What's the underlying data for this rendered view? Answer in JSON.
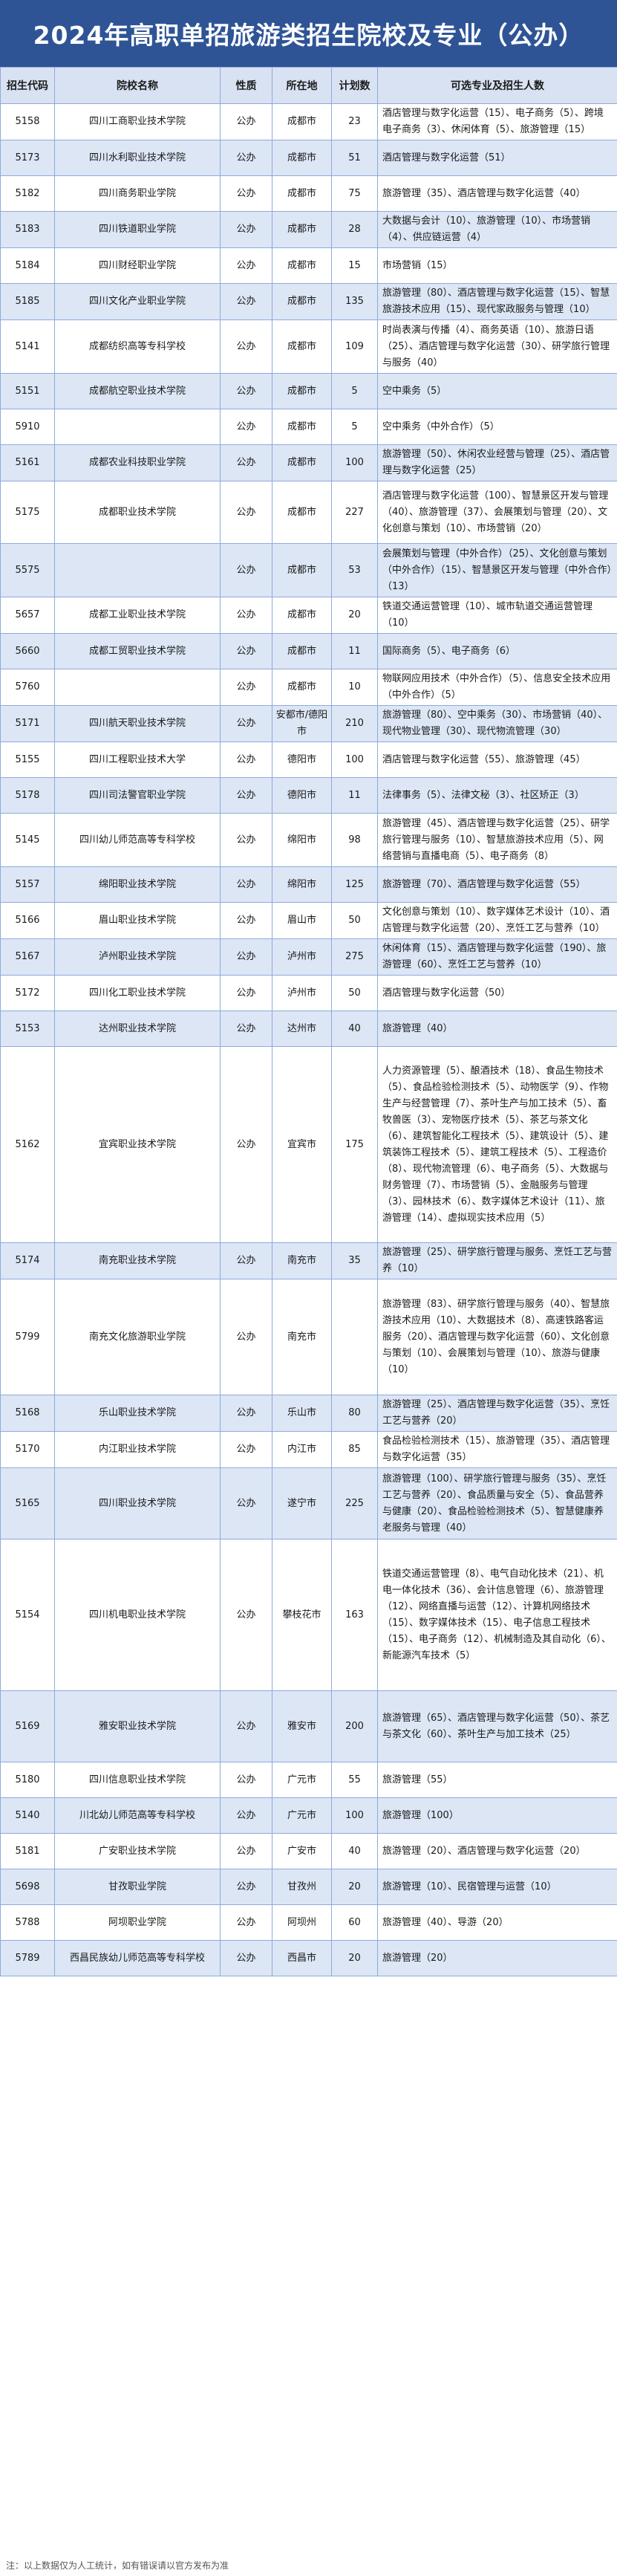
{
  "title": "2024年高职单招旅游类招生院校及专业（公办）",
  "headers": [
    "招生代码",
    "院校名称",
    "性质",
    "所在地",
    "计划数",
    "可选专业及招生人数"
  ],
  "rows": [
    {
      "code": "5158",
      "school": "四川工商职业技术学院",
      "type": "公办",
      "city": "成都市",
      "plan": "23",
      "majors": "酒店管理与数字化运营（15）、电子商务（5）、跨境电子商务（3）、休闲体育（5）、旅游管理（15）"
    },
    {
      "code": "5173",
      "school": "四川水利职业技术学院",
      "type": "公办",
      "city": "成都市",
      "plan": "51",
      "majors": "酒店管理与数字化运营（51）"
    },
    {
      "code": "5182",
      "school": "四川商务职业学院",
      "type": "公办",
      "city": "成都市",
      "plan": "75",
      "majors": "旅游管理（35）、酒店管理与数字化运营（40）"
    },
    {
      "code": "5183",
      "school": "四川铁道职业学院",
      "type": "公办",
      "city": "成都市",
      "plan": "28",
      "majors": "大数据与会计（10）、旅游管理（10）、市场营销（4）、供应链运营（4）"
    },
    {
      "code": "5184",
      "school": "四川财经职业学院",
      "type": "公办",
      "city": "成都市",
      "plan": "15",
      "majors": "市场营销（15）"
    },
    {
      "code": "5185",
      "school": "四川文化产业职业学院",
      "type": "公办",
      "city": "成都市",
      "plan": "135",
      "majors": "旅游管理（80）、酒店管理与数字化运营（15）、智慧旅游技术应用（15）、现代家政服务与管理（10）"
    },
    {
      "code": "5141",
      "school": "成都纺织高等专科学校",
      "type": "公办",
      "city": "成都市",
      "plan": "109",
      "majors": "时尚表演与传播（4）、商务英语（10）、旅游日语（25）、酒店管理与数字化运营（30）、研学旅行管理与服务（40）"
    },
    {
      "code": "5151",
      "school": "成都航空职业技术学院",
      "type": "公办",
      "city": "成都市",
      "plan": "5",
      "majors": "空中乘务（5）"
    },
    {
      "code": "5910",
      "school": "",
      "type": "公办",
      "city": "成都市",
      "plan": "5",
      "majors": "空中乘务（中外合作）（5）"
    },
    {
      "code": "5161",
      "school": "成都农业科技职业学院",
      "type": "公办",
      "city": "成都市",
      "plan": "100",
      "majors": "旅游管理（50）、休闲农业经营与管理（25）、酒店管理与数字化运营（25）"
    },
    {
      "code": "5175",
      "school": "成都职业技术学院",
      "type": "公办",
      "city": "成都市",
      "plan": "227",
      "majors": "酒店管理与数字化运营（100）、智慧景区开发与管理（40）、旅游管理（37）、会展策划与管理（20）、文化创意与策划（10）、市场营销（20）"
    },
    {
      "code": "5575",
      "school": "",
      "type": "公办",
      "city": "成都市",
      "plan": "53",
      "majors": "会展策划与管理（中外合作）（25）、文化创意与策划（中外合作）（15）、智慧景区开发与管理（中外合作）（13）"
    },
    {
      "code": "5657",
      "school": "成都工业职业技术学院",
      "type": "公办",
      "city": "成都市",
      "plan": "20",
      "majors": "铁道交通运营管理（10）、城市轨道交通运营管理（10）"
    },
    {
      "code": "5660",
      "school": "成都工贸职业技术学院",
      "type": "公办",
      "city": "成都市",
      "plan": "11",
      "majors": "国际商务（5）、电子商务（6）"
    },
    {
      "code": "5760",
      "school": "",
      "type": "公办",
      "city": "成都市",
      "plan": "10",
      "majors": "物联网应用技术（中外合作）（5）、信息安全技术应用（中外合作）（5）"
    },
    {
      "code": "5171",
      "school": "四川航天职业技术学院",
      "type": "公办",
      "city": "安都市/德阳市",
      "plan": "210",
      "majors": "旅游管理（80）、空中乘务（30）、市场营销（40）、现代物业管理（30）、现代物流管理（30）"
    },
    {
      "code": "5155",
      "school": "四川工程职业技术大学",
      "type": "公办",
      "city": "德阳市",
      "plan": "100",
      "majors": "酒店管理与数字化运营（55）、旅游管理（45）"
    },
    {
      "code": "5178",
      "school": "四川司法警官职业学院",
      "type": "公办",
      "city": "德阳市",
      "plan": "11",
      "majors": "法律事务（5）、法律文秘（3）、社区矫正（3）"
    },
    {
      "code": "5145",
      "school": "四川幼儿师范高等专科学校",
      "type": "公办",
      "city": "绵阳市",
      "plan": "98",
      "majors": "旅游管理（45）、酒店管理与数字化运营（25）、研学旅行管理与服务（10）、智慧旅游技术应用（5）、网络营销与直播电商（5）、电子商务（8）"
    },
    {
      "code": "5157",
      "school": "绵阳职业技术学院",
      "type": "公办",
      "city": "绵阳市",
      "plan": "125",
      "majors": "旅游管理（70）、酒店管理与数字化运营（55）"
    },
    {
      "code": "5166",
      "school": "眉山职业技术学院",
      "type": "公办",
      "city": "眉山市",
      "plan": "50",
      "majors": "文化创意与策划（10）、数字媒体艺术设计（10）、酒店管理与数字化运营（20）、烹饪工艺与营养（10）"
    },
    {
      "code": "5167",
      "school": "泸州职业技术学院",
      "type": "公办",
      "city": "泸州市",
      "plan": "275",
      "majors": "休闲体育（15）、酒店管理与数字化运营（190）、旅游管理（60）、烹饪工艺与营养（10）"
    },
    {
      "code": "5172",
      "school": "四川化工职业技术学院",
      "type": "公办",
      "city": "泸州市",
      "plan": "50",
      "majors": "酒店管理与数字化运营（50）"
    },
    {
      "code": "5153",
      "school": "达州职业技术学院",
      "type": "公办",
      "city": "达州市",
      "plan": "40",
      "majors": "旅游管理（40）"
    },
    {
      "code": "5162",
      "school": "宜宾职业技术学院",
      "type": "公办",
      "city": "宜宾市",
      "plan": "175",
      "majors": "人力资源管理（5）、酿酒技术（18）、食品生物技术（5）、食品检验检测技术（5）、动物医学（9）、作物生产与经营管理（7）、茶叶生产与加工技术（5）、畜牧兽医（3）、宠物医疗技术（5）、茶艺与茶文化（6）、建筑智能化工程技术（5）、建筑设计（5）、建筑装饰工程技术（5）、建筑工程技术（5）、工程造价（8）、现代物流管理（6）、电子商务（5）、大数据与财务管理（7）、市场营销（5）、金融服务与管理（3）、园林技术（6）、数字媒体艺术设计（11）、旅游管理（14）、虚拟现实技术应用（5）"
    },
    {
      "code": "5174",
      "school": "南充职业技术学院",
      "type": "公办",
      "city": "南充市",
      "plan": "35",
      "majors": "旅游管理（25）、研学旅行管理与服务、烹饪工艺与营养（10）"
    },
    {
      "code": "5799",
      "school": "南充文化旅游职业学院",
      "type": "公办",
      "city": "南充市",
      "plan": "",
      "majors": "旅游管理（83）、研学旅行管理与服务（40）、智慧旅游技术应用（10）、大数据技术（8）、高速铁路客运服务（20）、酒店管理与数字化运营（60）、文化创意与策划（10）、会展策划与管理（10）、旅游与健康（10）"
    },
    {
      "code": "5168",
      "school": "乐山职业技术学院",
      "type": "公办",
      "city": "乐山市",
      "plan": "80",
      "majors": "旅游管理（25）、酒店管理与数字化运营（35）、烹饪工艺与营养（20）"
    },
    {
      "code": "5170",
      "school": "内江职业技术学院",
      "type": "公办",
      "city": "内江市",
      "plan": "85",
      "majors": "食品检验检测技术（15）、旅游管理（35）、酒店管理与数字化运营（35）"
    },
    {
      "code": "5165",
      "school": "四川职业技术学院",
      "type": "公办",
      "city": "遂宁市",
      "plan": "225",
      "majors": "旅游管理（100）、研学旅行管理与服务（35）、烹饪工艺与营养（20）、食品质量与安全（5）、食品营养与健康（20）、食品检验检测技术（5）、智慧健康养老服务与管理（40）"
    },
    {
      "code": "5154",
      "school": "四川机电职业技术学院",
      "type": "公办",
      "city": "攀枝花市",
      "plan": "163",
      "majors": "铁道交通运营管理（8）、电气自动化技术（21）、机电一体化技术（36）、会计信息管理（6）、旅游管理（12）、网络直播与运营（12）、计算机网络技术（15）、数字媒体技术（15）、电子信息工程技术（15）、电子商务（12）、机械制造及其自动化（6）、新能源汽车技术（5）"
    },
    {
      "code": "5169",
      "school": "雅安职业技术学院",
      "type": "公办",
      "city": "雅安市",
      "plan": "200",
      "majors": "旅游管理（65）、酒店管理与数字化运营（50）、茶艺与茶文化（60）、茶叶生产与加工技术（25）"
    },
    {
      "code": "5180",
      "school": "四川信息职业技术学院",
      "type": "公办",
      "city": "广元市",
      "plan": "55",
      "majors": "旅游管理（55）"
    },
    {
      "code": "5140",
      "school": "川北幼儿师范高等专科学校",
      "type": "公办",
      "city": "广元市",
      "plan": "100",
      "majors": "旅游管理（100）"
    },
    {
      "code": "5181",
      "school": "广安职业技术学院",
      "type": "公办",
      "city": "广安市",
      "plan": "40",
      "majors": "旅游管理（20）、酒店管理与数字化运营（20）"
    },
    {
      "code": "5698",
      "school": "甘孜职业学院",
      "type": "公办",
      "city": "甘孜州",
      "plan": "20",
      "majors": "旅游管理（10）、民宿管理与运营（10）"
    },
    {
      "code": "5788",
      "school": "阿坝职业学院",
      "type": "公办",
      "city": "阿坝州",
      "plan": "60",
      "majors": "旅游管理（40）、导游（20）"
    },
    {
      "code": "5789",
      "school": "西昌民族幼儿师范高等专科学校",
      "type": "公办",
      "city": "西昌市",
      "plan": "20",
      "majors": "旅游管理（20）"
    }
  ],
  "footer": "注：以上数据仅为人工统计，如有错误请以官方发布为准"
}
